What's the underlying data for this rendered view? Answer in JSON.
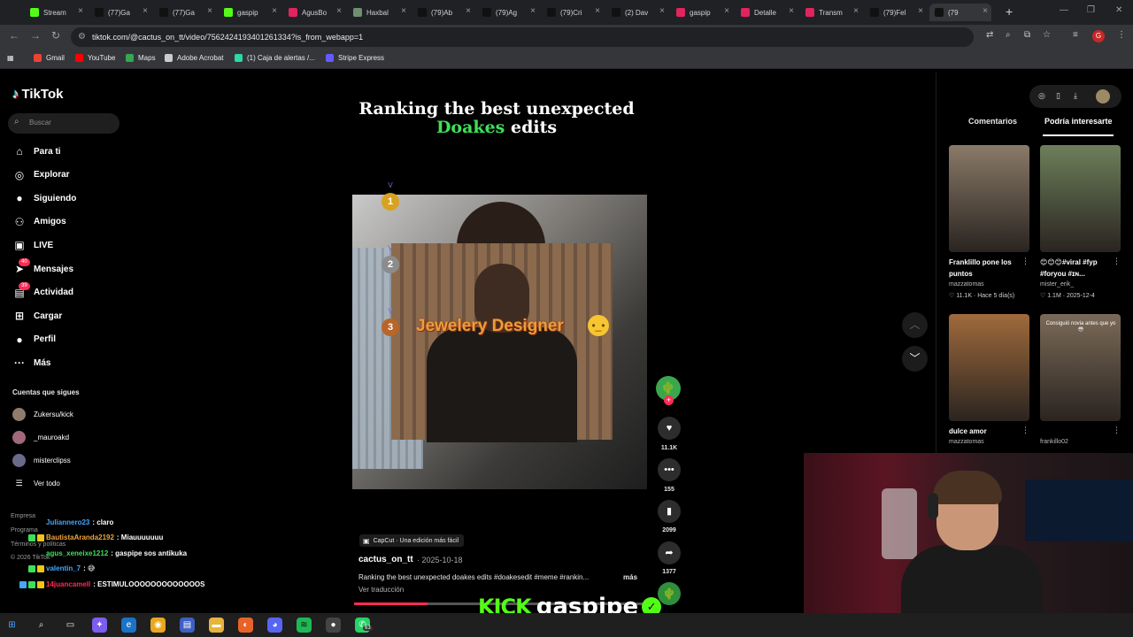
{
  "browser": {
    "tabs": [
      {
        "label": "Stream",
        "color": "#53fc18"
      },
      {
        "label": "(77)Ga",
        "color": "#111111"
      },
      {
        "label": "(77)Ga",
        "color": "#111111"
      },
      {
        "label": "gaspip",
        "color": "#53fc18"
      },
      {
        "label": "AgusBo",
        "color": "#e0245e"
      },
      {
        "label": "Haxbal",
        "color": "#6f8f6f"
      },
      {
        "label": "(79)Ab",
        "color": "#111111"
      },
      {
        "label": "(79)Ag",
        "color": "#111111"
      },
      {
        "label": "(79)Cri",
        "color": "#111111"
      },
      {
        "label": "(2) Dav",
        "color": "#111111"
      },
      {
        "label": "gaspip",
        "color": "#e0245e"
      },
      {
        "label": "Detalle",
        "color": "#e0245e"
      },
      {
        "label": "Transm",
        "color": "#e0245e"
      },
      {
        "label": "(79)Fel",
        "color": "#111111"
      },
      {
        "label": "(79",
        "color": "#111111"
      }
    ],
    "url": "tiktok.com/@cactus_on_tt/video/7562424193401261334?is_from_webapp=1",
    "profile_initial": "G",
    "bookmarks": [
      {
        "label": "Gmail",
        "color": "#ea4335"
      },
      {
        "label": "YouTube",
        "color": "#ff0000"
      },
      {
        "label": "Maps",
        "color": "#34a853"
      },
      {
        "label": "Adobe Acrobat",
        "color": "#cccccc"
      },
      {
        "label": "(1) Caja de alertas /...",
        "color": "#2bd9a6"
      },
      {
        "label": "Stripe Express",
        "color": "#635bff"
      }
    ]
  },
  "tiktok": {
    "logo": "TikTok",
    "search_placeholder": "Buscar",
    "nav": [
      {
        "label": "Para ti",
        "icon": "home-icon"
      },
      {
        "label": "Explorar",
        "icon": "compass-icon"
      },
      {
        "label": "Siguiendo",
        "icon": "following-icon"
      },
      {
        "label": "Amigos",
        "icon": "friends-icon"
      },
      {
        "label": "LIVE",
        "icon": "live-icon"
      },
      {
        "label": "Mensajes",
        "icon": "messages-icon",
        "badge": "40"
      },
      {
        "label": "Actividad",
        "icon": "activity-icon",
        "badge": "39"
      },
      {
        "label": "Cargar",
        "icon": "upload-icon"
      },
      {
        "label": "Perfil",
        "icon": "profile-icon"
      },
      {
        "label": "Más",
        "icon": "more-icon"
      }
    ],
    "following_title": "Cuentas que sigues",
    "following": [
      "Zukersu/kick",
      "_mauroakd",
      "misterclipss"
    ],
    "see_all": "Ver todo",
    "footer": [
      "Empresa",
      "Programa",
      "Términos y políticas",
      "© 2026 TikTok"
    ]
  },
  "video": {
    "title_line1": "Ranking the best unexpected",
    "title_highlight": "Doakes",
    "title_line2": "edits",
    "overlay_text": "Jewelery Designer",
    "ranks": [
      "1",
      "2",
      "3"
    ],
    "likes": "11.1K",
    "comments": "155",
    "saves": "2099",
    "shares": "1377",
    "capcut_label": "CapCut · Una edición más fácil",
    "author": "cactus_on_tt",
    "date": "2025-10-18",
    "description": "Ranking the best unexpected doakes edits #doakesedit #meme #rankin...",
    "more": "más",
    "translate": "Ver traducción",
    "progress": 0.25
  },
  "right_panel": {
    "tabs": [
      "Comentarios",
      "Podría interesarte"
    ],
    "items": [
      {
        "caption": "Franklillo pone los puntos",
        "user": "mazzatomas",
        "stats": "♡ 11.1K · Hace 5 día(s)",
        "bg": "#8a7a68"
      },
      {
        "caption": "😊😊😊#viral #fyp #foryou #ɪɴ...",
        "user": "mister_erik_",
        "stats": "♡ 1.1M · 2025-12-4",
        "bg": "#6d7f5a"
      },
      {
        "caption": "dulce amor",
        "user": "mazzatomas",
        "stats": "",
        "bg": "#a06a3c"
      },
      {
        "caption": "",
        "user": "frankillo02",
        "stats": "",
        "bg": "#7b6a58",
        "overlay": "Consiguió novia antes que yo 😳"
      }
    ]
  },
  "chat": [
    {
      "user": "Juliannero23",
      "color": "#43a7ff",
      "msg": ": claro",
      "badges": []
    },
    {
      "user": "BautistaAranda2192",
      "color": "#f0a43b",
      "msg": ": Miauuuuuuu",
      "badges": [
        "#3ee05a",
        "#f0c419"
      ]
    },
    {
      "user": "agus_xeneixe1212",
      "color": "#3ee05a",
      "msg": ": gaspipe sos antikuka",
      "badges": []
    },
    {
      "user": "valentin_7",
      "color": "#43a7ff",
      "msg": ": 😅",
      "badges": [
        "#3ee05a",
        "#f0c419"
      ]
    },
    {
      "user": "14juancamell",
      "color": "#fe2c55",
      "msg": ": ESTIMULOOOOOOOOOOOOOS",
      "badges": [
        "#43a7ff",
        "#3ee05a",
        "#f0c419"
      ]
    }
  ],
  "kick": {
    "brand": "KICK",
    "streamer": "gaspipe"
  },
  "taskbar": {
    "whatsapp_badge": "63"
  }
}
